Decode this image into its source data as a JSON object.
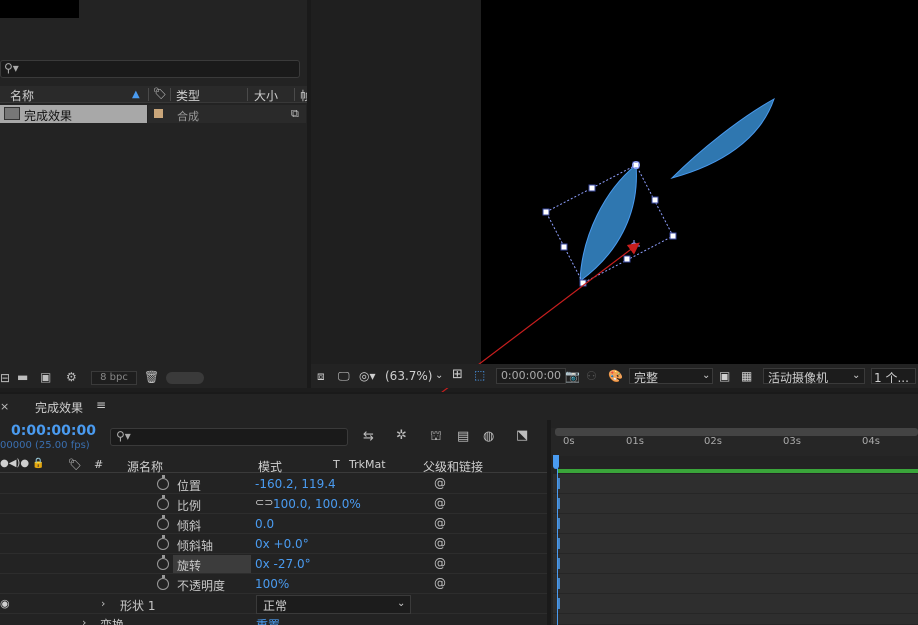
{
  "project": {
    "columns": {
      "name": "名称",
      "type": "类型",
      "size": "大小",
      "extra": "帧"
    },
    "item": {
      "name": "完成效果",
      "type": "合成"
    },
    "bpc": "8 bpc"
  },
  "viewer": {
    "zoom": "(63.7%)",
    "timecode": "0:00:00:00",
    "resolution": "完整",
    "camera": "活动摄像机",
    "views": "1 个..."
  },
  "timeline": {
    "comp_name": "完成效果",
    "current_time": "0:00:00:00",
    "fps": "00000 (25.00 fps)",
    "columns": {
      "hash": "#",
      "source_name": "源名称",
      "mode": "模式",
      "t": "T",
      "trkmat": "TrkMat",
      "parent": "父级和链接"
    },
    "properties": [
      {
        "name": "位置",
        "value": "-160.2, 119.4"
      },
      {
        "name": "比例",
        "value": "100.0, 100.0%"
      },
      {
        "name": "倾斜",
        "value": "0.0"
      },
      {
        "name": "倾斜轴",
        "value": "0x +0.0°"
      },
      {
        "name": "旋转",
        "value": "0x -27.0°"
      },
      {
        "name": "不透明度",
        "value": "100%"
      }
    ],
    "shape_layer": {
      "name": "形状 1",
      "mode": "正常"
    },
    "transform_label": "变换",
    "transform_value": "重置",
    "ruler_ticks": [
      "0s",
      "01s",
      "02s",
      "03s",
      "04s"
    ]
  },
  "colors": {
    "accent": "#4a9bf0",
    "shape_fill": "#2f77b0",
    "arrow": "#c81e1e",
    "bar_green": "#3aa53a"
  }
}
